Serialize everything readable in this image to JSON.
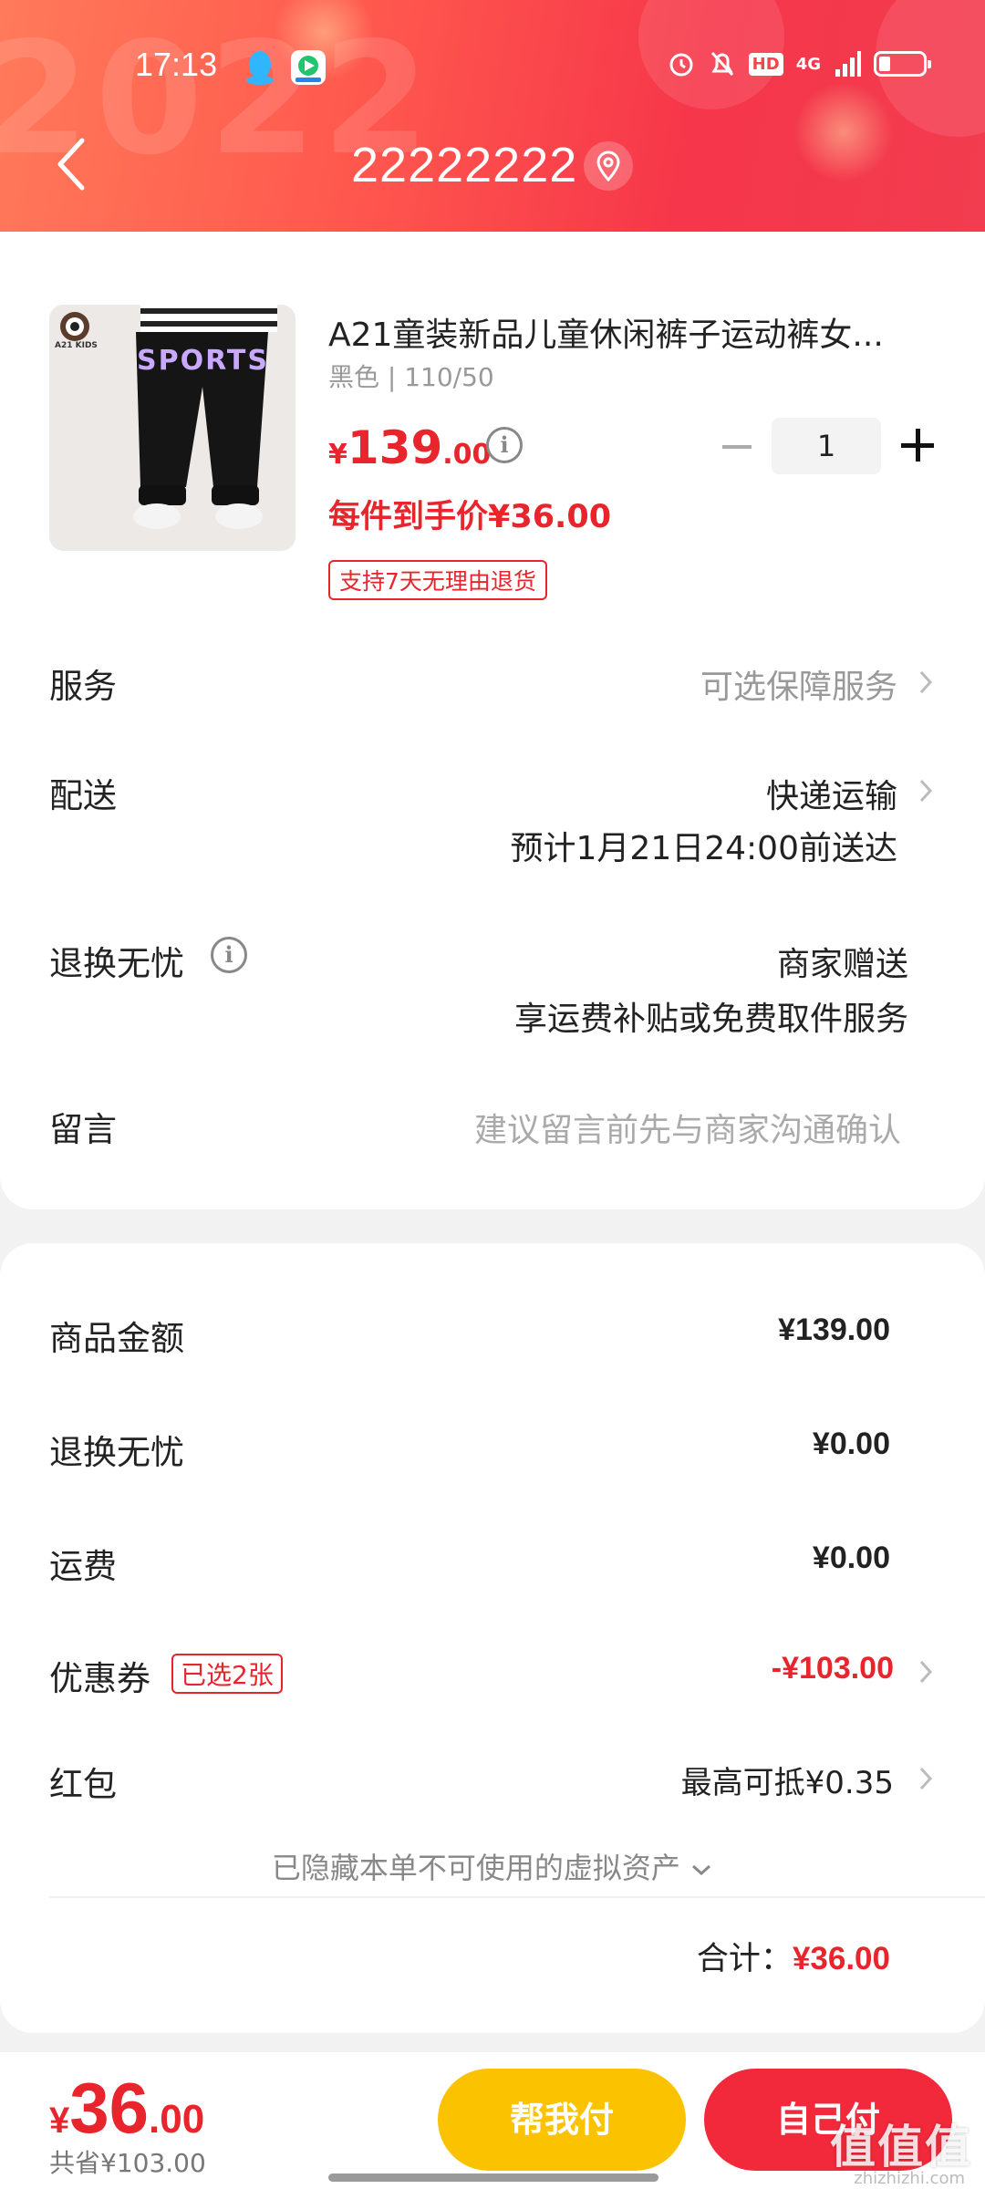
{
  "status_bar": {
    "time": "17:13",
    "hd": "HD",
    "network": "4G"
  },
  "header": {
    "title": "22222222",
    "decor_text": "2022"
  },
  "product": {
    "name": "A21童装新品儿童休闲裤子运动裤女...",
    "spec": "黑色 | 110/50",
    "image_brand": "A21 KIDS",
    "image_text": "SPORTS",
    "price_currency": "¥",
    "price_integer": "139",
    "price_decimal": ".00",
    "quantity": "1",
    "unit_price_label": "每件到手价¥36.00",
    "return_badge": "支持7天无理由退货"
  },
  "rows": {
    "service_label": "服务",
    "service_value": "可选保障服务",
    "delivery_label": "配送",
    "delivery_value": "快递运输",
    "delivery_eta": "预计1月21日24:00前送达",
    "worry_free_label": "退换无忧",
    "worry_free_value": "商家赠送",
    "worry_free_desc": "享运费补贴或免费取件服务",
    "message_label": "留言",
    "message_placeholder": "建议留言前先与商家沟通确认"
  },
  "summary": {
    "goods_label": "商品金额",
    "goods_value": "¥139.00",
    "worry_free_label": "退换无忧",
    "worry_free_value": "¥0.00",
    "shipping_label": "运费",
    "shipping_value": "¥0.00",
    "coupon_label": "优惠券",
    "coupon_badge": "已选2张",
    "coupon_value": "-¥103.00",
    "redpacket_label": "红包",
    "redpacket_value": "最高可抵¥0.35",
    "hidden_assets": "已隐藏本单不可使用的虚拟资产",
    "total_label": "合计：",
    "total_value": "¥36.00"
  },
  "bottom": {
    "pay_currency": "¥",
    "pay_integer": "36",
    "pay_decimal": ".00",
    "saved": "共省¥103.00",
    "help_pay_label": "帮我付",
    "self_pay_label": "自己付",
    "watermark": "值值值",
    "watermark_sub": "zhizhizhi.com"
  },
  "colors": {
    "accent_red": "#e8242c",
    "help_pay_yellow": "#fbc200",
    "self_pay_red": "#f2293a",
    "header_gradient_start": "#ff7a5a",
    "header_gradient_end": "#f23c4f"
  },
  "icons": [
    "back-arrow-icon",
    "location-pin-icon",
    "qq-icon",
    "video-app-icon",
    "alarm-icon",
    "mute-bell-icon",
    "signal-icon",
    "battery-icon",
    "info-icon",
    "chevron-right-icon",
    "chevron-down-icon"
  ]
}
